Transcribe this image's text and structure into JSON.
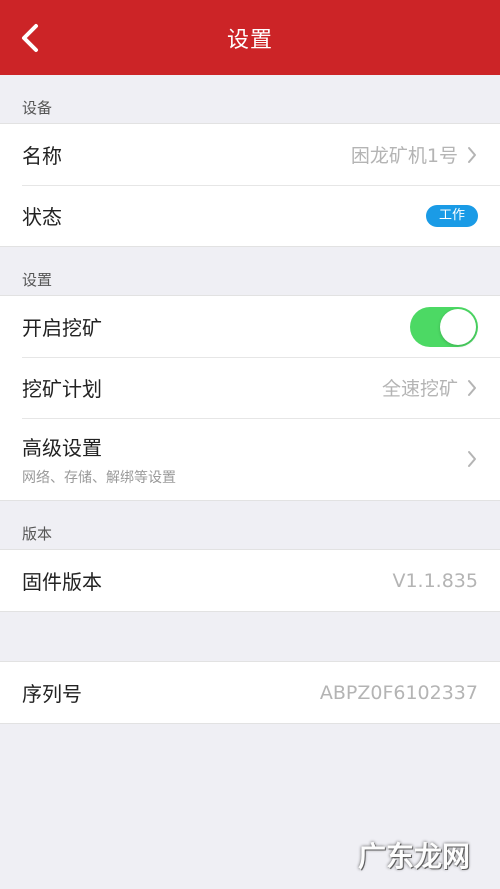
{
  "header": {
    "title": "设置",
    "background_color": "#cc2427"
  },
  "sections": {
    "device": {
      "label": "设备",
      "rows": {
        "name": {
          "label": "名称",
          "value": "困龙矿机1号"
        },
        "status": {
          "label": "状态",
          "badge": "工作",
          "badge_color": "#1a9be6"
        }
      }
    },
    "settings": {
      "label": "设置",
      "rows": {
        "mining": {
          "label": "开启挖矿",
          "toggle_on": true,
          "toggle_color": "#4cd964"
        },
        "plan": {
          "label": "挖矿计划",
          "value": "全速挖矿"
        },
        "advanced": {
          "label": "高级设置",
          "sublabel": "网络、存储、解绑等设置"
        }
      }
    },
    "version": {
      "label": "版本",
      "rows": {
        "firmware": {
          "label": "固件版本",
          "value": "V1.1.835"
        }
      }
    },
    "serial": {
      "rows": {
        "serial_number": {
          "label": "序列号",
          "value": "ABPZ0F6102337"
        }
      }
    }
  },
  "watermark": {
    "text": "广东龙网"
  }
}
